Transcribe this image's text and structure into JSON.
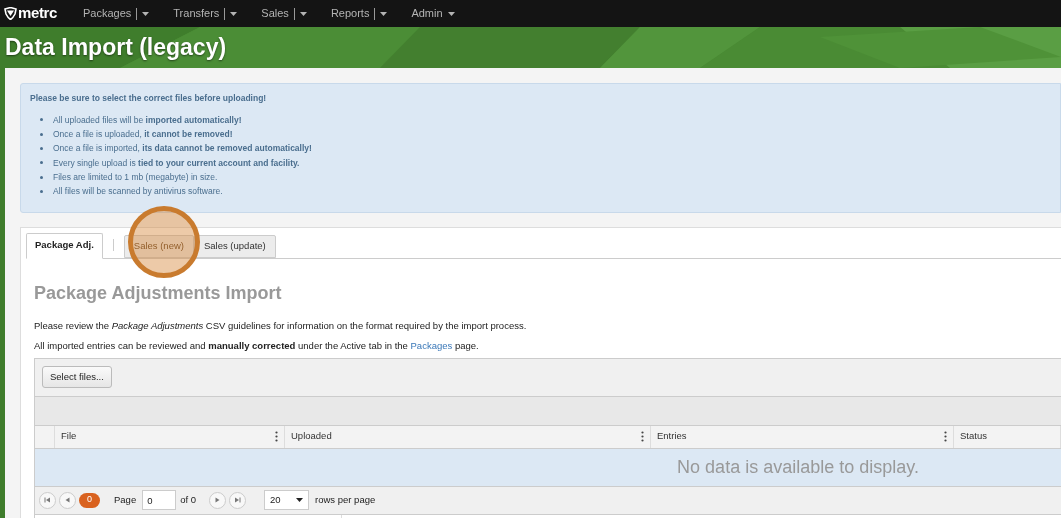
{
  "navbar": {
    "logo": "metrc",
    "items": [
      {
        "label": "Packages",
        "split": true
      },
      {
        "label": "Transfers",
        "split": true
      },
      {
        "label": "Sales",
        "split": true
      },
      {
        "label": "Reports",
        "split": true
      },
      {
        "label": "Admin",
        "split": false
      }
    ]
  },
  "page_title": "Data Import (legacy)",
  "alert": {
    "heading": "Please be sure to select the correct files before uploading!",
    "bullets": [
      "All uploaded files will be **imported automatically!**",
      "Once a file is uploaded, **it cannot be removed!**",
      "Once a file is imported, **its data cannot be removed automatically!**",
      "Every single upload is **tied to your current account and facility.**",
      "Files are limited to 1 mb (megabyte) in size.",
      "All files will be scanned by antivirus software."
    ]
  },
  "tabs": [
    {
      "label": "Package Adj.",
      "selected": true
    },
    {
      "label": "Sales (new)",
      "selected": false,
      "disabled": true
    },
    {
      "label": "Sales (update)",
      "selected": false,
      "disabled": false
    }
  ],
  "panel": {
    "heading": "Package Adjustments Import",
    "intro": "Please review the *Package Adjustments* CSV guidelines for information on the format required by the import process.",
    "note": {
      "before": "All imported entries can be reviewed and **manually corrected** under the Active tab in the ",
      "link": "Packages",
      "after": " page."
    }
  },
  "grid": {
    "toolbar_button": "Select files...",
    "columns": [
      "File",
      "Uploaded",
      "Entries",
      "Status"
    ],
    "empty_message": "No data is available to display.",
    "pager": {
      "current_page": "0",
      "page_label": "Page",
      "page_value": "0",
      "of_label": "of 0",
      "page_size": "20",
      "size_label": "rows per page"
    }
  },
  "click_marker": true
}
